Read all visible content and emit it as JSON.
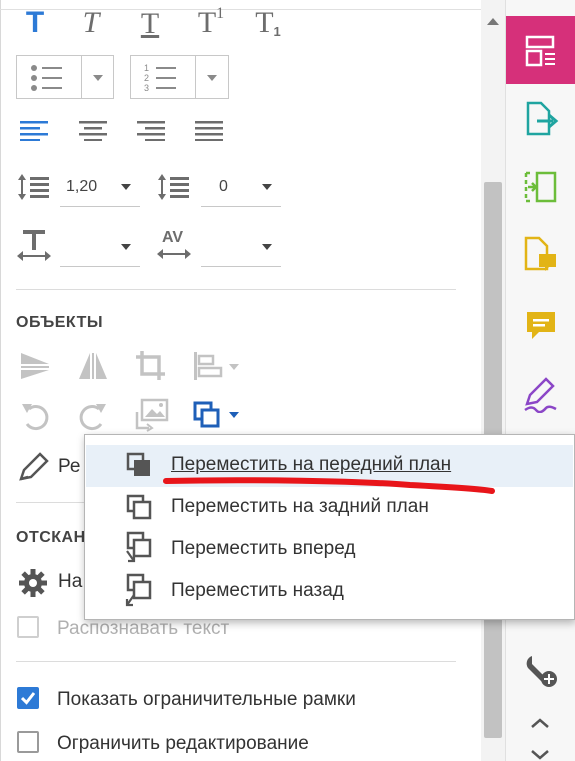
{
  "panel": {
    "format_icons": [
      "text-bold-icon",
      "text-italic-icon",
      "text-underline-icon",
      "superscript-icon",
      "subscript-icon"
    ],
    "format_glyphs": {
      "bold": "T",
      "italic": "T",
      "underline": "T",
      "sup_base": "T",
      "sup_mark": "1",
      "sub_base": "T",
      "sub_mark": "1"
    },
    "spacing": {
      "line_spacing_value": "1,20",
      "paragraph_spacing_value": "0",
      "horizontal_scale_value": "",
      "char_spacing_value": "",
      "char_spacing_glyph": "AV"
    },
    "objects": {
      "title": "ОБЪЕКТЫ",
      "edit_label_partial": "Ре"
    },
    "scanned": {
      "title_partial": "ОТСКАН",
      "settings_partial": "На",
      "recognize_text": "Распознавать текст"
    },
    "checkboxes": {
      "show_bounding_boxes": "Показать ограничительные рамки",
      "restrict_editing": "Ограничить редактирование"
    }
  },
  "arrange_menu": {
    "items": [
      {
        "label": "Переместить на передний план",
        "icon": "bring-to-front-icon",
        "highlighted": true
      },
      {
        "label": "Переместить на задний план",
        "icon": "send-to-back-icon",
        "highlighted": false
      },
      {
        "label": "Переместить вперед",
        "icon": "bring-forward-icon",
        "highlighted": false
      },
      {
        "label": "Переместить назад",
        "icon": "send-backward-icon",
        "highlighted": false
      }
    ]
  },
  "rail": {
    "tools": [
      "edit-pdf-icon",
      "export-pdf-icon",
      "organize-pages-icon",
      "comment-file-icon",
      "comment-icon",
      "fill-sign-icon",
      "more-tools-icon"
    ]
  },
  "colors": {
    "accent_blue": "#2d7ad6",
    "rail_active": "#d6307a",
    "highlight_bar": "#e8f0f8",
    "annotation_red": "#e8151a"
  }
}
